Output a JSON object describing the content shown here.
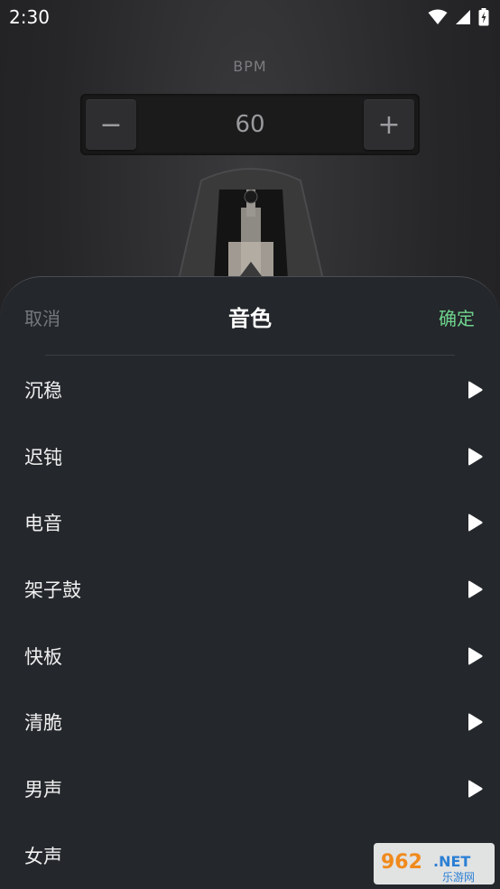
{
  "status_bar": {
    "time": "2:30"
  },
  "metronome": {
    "bpm_label": "BPM",
    "bpm_value": "60",
    "minus_label": "−",
    "plus_label": "+"
  },
  "sheet": {
    "cancel_label": "取消",
    "title": "音色",
    "confirm_label": "确定",
    "items": [
      {
        "label": "沉稳"
      },
      {
        "label": "迟钝"
      },
      {
        "label": "电音"
      },
      {
        "label": "架子鼓"
      },
      {
        "label": "快板"
      },
      {
        "label": "清脆"
      },
      {
        "label": "男声"
      },
      {
        "label": "女声"
      }
    ]
  },
  "watermark": {
    "text": "962.NET",
    "subtext": "乐游网"
  },
  "colors": {
    "accent": "#6fd38d",
    "sheet_bg": "#24272b",
    "background": "#2a2a2c"
  }
}
